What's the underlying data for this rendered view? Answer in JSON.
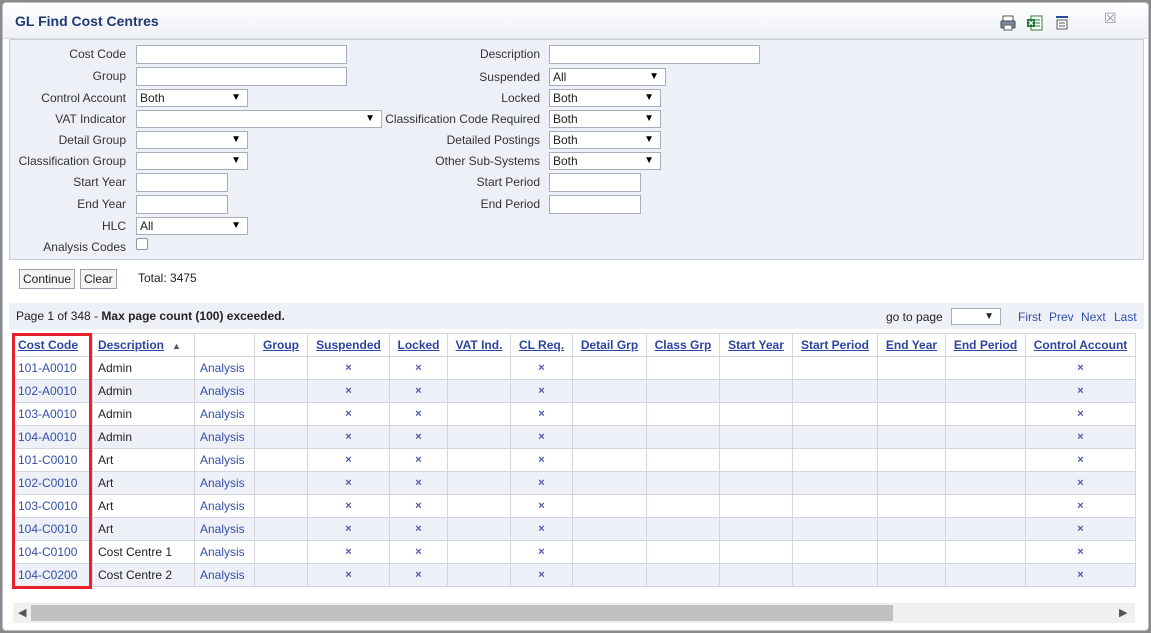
{
  "title": "GL Find Cost Centres",
  "toolbar_icons": [
    "print-icon",
    "excel-icon",
    "columns-icon",
    "close-icon"
  ],
  "close_glyph": "☒",
  "filters": {
    "cost_code": {
      "label": "Cost Code",
      "value": ""
    },
    "group": {
      "label": "Group",
      "value": ""
    },
    "control_account": {
      "label": "Control Account",
      "value": "Both"
    },
    "vat_indicator": {
      "label": "VAT Indicator",
      "value": ""
    },
    "detail_group": {
      "label": "Detail Group",
      "value": ""
    },
    "classification_group": {
      "label": "Classification Group",
      "value": ""
    },
    "start_year": {
      "label": "Start Year",
      "value": ""
    },
    "end_year": {
      "label": "End Year",
      "value": ""
    },
    "hlc": {
      "label": "HLC",
      "value": "All"
    },
    "analysis_codes": {
      "label": "Analysis Codes",
      "checked": false
    },
    "description": {
      "label": "Description",
      "value": ""
    },
    "suspended": {
      "label": "Suspended",
      "value": "All"
    },
    "locked": {
      "label": "Locked",
      "value": "Both"
    },
    "classification_code_required": {
      "label": "Classification Code Required",
      "value": "Both"
    },
    "detailed_postings": {
      "label": "Detailed Postings",
      "value": "Both"
    },
    "other_sub_systems": {
      "label": "Other Sub-Systems",
      "value": "Both"
    },
    "start_period": {
      "label": "Start Period",
      "value": ""
    },
    "end_period": {
      "label": "End Period",
      "value": ""
    }
  },
  "buttons": {
    "continue": "Continue",
    "clear": "Clear"
  },
  "total": "Total: 3475",
  "pager": {
    "page_text": "Page 1 of 348 - ",
    "warning": "Max page count (100) exceeded.",
    "goto_label": "go to page",
    "first": "First",
    "prev": "Prev",
    "next": "Next",
    "last": "Last"
  },
  "arrow_glyph": "▼",
  "sort_glyph": "▲",
  "table": {
    "headers": [
      "Cost Code",
      "Description",
      "",
      "Group",
      "Suspended",
      "Locked",
      "VAT Ind.",
      "CL Req.",
      "Detail Grp",
      "Class Grp",
      "Start Year",
      "Start Period",
      "End Year",
      "End Period",
      "Control Account"
    ],
    "mark": "×",
    "rows": [
      {
        "code": "101-A0010",
        "description": "Admin",
        "analysis": "Analysis"
      },
      {
        "code": "102-A0010",
        "description": "Admin",
        "analysis": "Analysis"
      },
      {
        "code": "103-A0010",
        "description": "Admin",
        "analysis": "Analysis"
      },
      {
        "code": "104-A0010",
        "description": "Admin",
        "analysis": "Analysis"
      },
      {
        "code": "101-C0010",
        "description": "Art",
        "analysis": "Analysis"
      },
      {
        "code": "102-C0010",
        "description": "Art",
        "analysis": "Analysis"
      },
      {
        "code": "103-C0010",
        "description": "Art",
        "analysis": "Analysis"
      },
      {
        "code": "104-C0010",
        "description": "Art",
        "analysis": "Analysis"
      },
      {
        "code": "104-C0100",
        "description": "Cost Centre 1",
        "analysis": "Analysis"
      },
      {
        "code": "104-C0200",
        "description": "Cost Centre 2",
        "analysis": "Analysis"
      }
    ]
  },
  "colors": {
    "highlight": "#e8202a",
    "link": "#3450a6",
    "panel": "#eef0f8"
  }
}
